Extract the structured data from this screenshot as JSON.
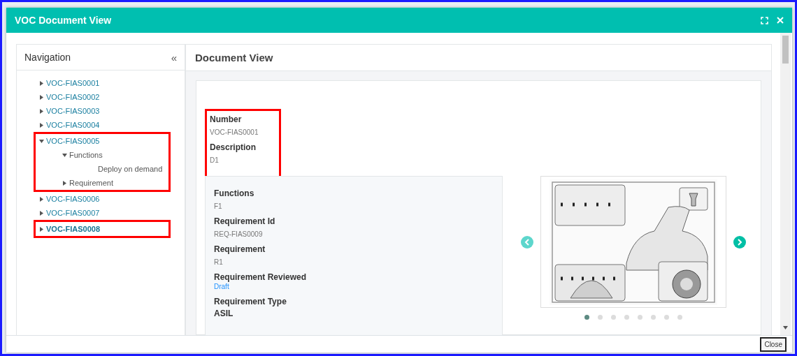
{
  "window": {
    "title": "VOC Document View"
  },
  "navigation": {
    "title": "Navigation",
    "collapse": "«",
    "tree": [
      {
        "label": "VOC-FIAS0001",
        "expanded": false,
        "selected": false,
        "highlighted": false
      },
      {
        "label": "VOC-FIAS0002",
        "expanded": false,
        "selected": false,
        "highlighted": false
      },
      {
        "label": "VOC-FIAS0003",
        "expanded": false,
        "selected": false,
        "highlighted": false
      },
      {
        "label": "VOC-FIAS0004",
        "expanded": false,
        "selected": false,
        "highlighted": false
      },
      {
        "label": "VOC-FIAS0005",
        "expanded": true,
        "selected": false,
        "highlighted": true,
        "children": [
          {
            "label": "Functions",
            "expanded": true,
            "selected": false,
            "children": [
              {
                "label": "Deploy on demand",
                "selected": false
              }
            ]
          },
          {
            "label": "Requirement",
            "expanded": false,
            "selected": false
          }
        ]
      },
      {
        "label": "VOC-FIAS0006",
        "expanded": false,
        "selected": false,
        "highlighted": false
      },
      {
        "label": "VOC-FIAS0007",
        "expanded": false,
        "selected": false,
        "highlighted": false
      },
      {
        "label": "VOC-FIAS0008",
        "expanded": false,
        "selected": true,
        "highlighted": true
      }
    ]
  },
  "document": {
    "title": "Document View",
    "header_highlighted": true,
    "header_fields": [
      {
        "label": "Number",
        "value": "VOC-FIAS0001",
        "kind": "plain"
      },
      {
        "label": "Description",
        "value": "D1",
        "kind": "plain"
      }
    ],
    "details": [
      {
        "label": "Functions",
        "value": "F1",
        "kind": "plain"
      },
      {
        "label": "Requirement Id",
        "value": "REQ-FIAS0009",
        "kind": "plain"
      },
      {
        "label": "Requirement",
        "value": "R1",
        "kind": "plain"
      },
      {
        "label": "Requirement Reviewed",
        "value": "Draft",
        "kind": "link"
      },
      {
        "label": "Requirement Type"
      },
      {
        "label": "ASIL"
      }
    ],
    "carousel": {
      "slides": [
        {
          "selected": true
        },
        {
          "selected": false
        },
        {
          "selected": false
        },
        {
          "selected": false
        },
        {
          "selected": false
        },
        {
          "selected": false
        },
        {
          "selected": false
        },
        {
          "selected": false
        }
      ]
    }
  },
  "buttons": [
    "Close"
  ]
}
